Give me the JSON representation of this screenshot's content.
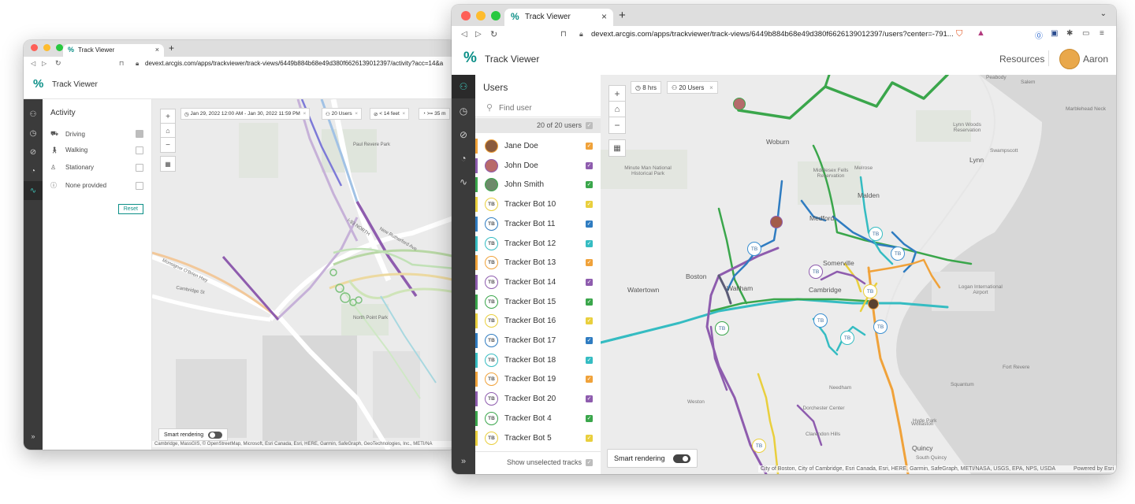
{
  "colors": {
    "accent": "#0b8f87",
    "orange": "#f0a23a",
    "purple": "#8e5cae",
    "green": "#3aa64b",
    "yellow": "#e9cf3d",
    "blue": "#2f7cc1",
    "teal": "#35bcc2"
  },
  "back": {
    "tab_title": "Track Viewer",
    "url": "devext.arcgis.com/apps/trackviewer/track-views/6449b884b68e49d380f6626139012397/activity?acc=14&a",
    "app_title": "Track Viewer",
    "panel_title": "Activity",
    "activities": [
      {
        "label": "Driving",
        "icon": "car-icon",
        "checked": true
      },
      {
        "label": "Walking",
        "icon": "walking-icon",
        "checked": false
      },
      {
        "label": "Stationary",
        "icon": "standing-icon",
        "checked": false
      },
      {
        "label": "None provided",
        "icon": "question-icon",
        "checked": false
      }
    ],
    "reset_label": "Reset",
    "chips": {
      "time": "Jan 29, 2022 12:00 AM - Jan 30, 2022 11:59 PM",
      "users": "20 Users",
      "accuracy": "< 14 feet",
      "speed": ">= 35 m"
    },
    "map_labels": {
      "road1": "I-93 NORTH",
      "road2": "Monsignor O'Brien Hwy",
      "road3": "Cambridge St",
      "road4": "New Rutherford Ave",
      "park": "Paul Revere Park",
      "north_point": "North Point Park"
    },
    "smart_rendering": "Smart rendering",
    "attribution": "Cambridge, MassGIS, © OpenStreetMap, Microsoft, Esri Canada, Esri, HERE, Garmin, SafeGraph, GeoTechnologies, Inc., METI/NA"
  },
  "front": {
    "tab_title": "Track Viewer",
    "url": "devext.arcgis.com/apps/trackviewer/track-views/6449b884b68e49d380f6626139012397/users?center=-791...",
    "app_title": "Track Viewer",
    "resources": "Resources",
    "user_name": "Aaron",
    "panel_title": "Users",
    "find_placeholder": "Find user",
    "count_label": "20 of 20 users",
    "users": [
      {
        "name": "Jane Doe",
        "color": "#f0a23a",
        "avatar": "photo"
      },
      {
        "name": "John Doe",
        "color": "#8e5cae",
        "avatar": "photo"
      },
      {
        "name": "John Smith",
        "color": "#3aa64b",
        "avatar": "photo"
      },
      {
        "name": "Tracker Bot 10",
        "color": "#e9cf3d",
        "avatar": "TB"
      },
      {
        "name": "Tracker Bot 11",
        "color": "#2f7cc1",
        "avatar": "TB"
      },
      {
        "name": "Tracker Bot 12",
        "color": "#35bcc2",
        "avatar": "TB"
      },
      {
        "name": "Tracker Bot 13",
        "color": "#f0a23a",
        "avatar": "TB"
      },
      {
        "name": "Tracker Bot 14",
        "color": "#8e5cae",
        "avatar": "TB"
      },
      {
        "name": "Tracker Bot 15",
        "color": "#3aa64b",
        "avatar": "TB"
      },
      {
        "name": "Tracker Bot 16",
        "color": "#e9cf3d",
        "avatar": "TB"
      },
      {
        "name": "Tracker Bot 17",
        "color": "#2f7cc1",
        "avatar": "TB"
      },
      {
        "name": "Tracker Bot 18",
        "color": "#35bcc2",
        "avatar": "TB"
      },
      {
        "name": "Tracker Bot 19",
        "color": "#f0a23a",
        "avatar": "TB"
      },
      {
        "name": "Tracker Bot 20",
        "color": "#8e5cae",
        "avatar": "TB"
      },
      {
        "name": "Tracker Bot 4",
        "color": "#3aa64b",
        "avatar": "TB"
      },
      {
        "name": "Tracker Bot 5",
        "color": "#e9cf3d",
        "avatar": "TB"
      }
    ],
    "show_unselected": "Show unselected tracks",
    "chips": {
      "time": "8 hrs",
      "users": "20 Users"
    },
    "map_places": [
      "Woburn",
      "Melrose",
      "Malden",
      "Medford",
      "Lynn",
      "Swampscott",
      "Salem",
      "Peabody",
      "Marblehead Neck",
      "Somerville",
      "Cambridge",
      "Boston",
      "Waltham",
      "Watertown",
      "Weston",
      "Needham",
      "Dorchester Center",
      "Clarendon Hills",
      "Hyde Park",
      "Quincy",
      "South Quincy",
      "Wollaston",
      "Squantum",
      "Fort Revere",
      "Logan International Airport",
      "Lynn Woods Reservation",
      "Middlesex Fells Reservation",
      "Minute Man National Historical Park"
    ],
    "smart_rendering": "Smart rendering",
    "attribution": "City of Boston, City of Cambridge, Esri Canada, Esri, HERE, Garmin, SafeGraph, METI/NASA, USGS, EPA, NPS, USDA",
    "powered_by": "Powered by Esri"
  }
}
